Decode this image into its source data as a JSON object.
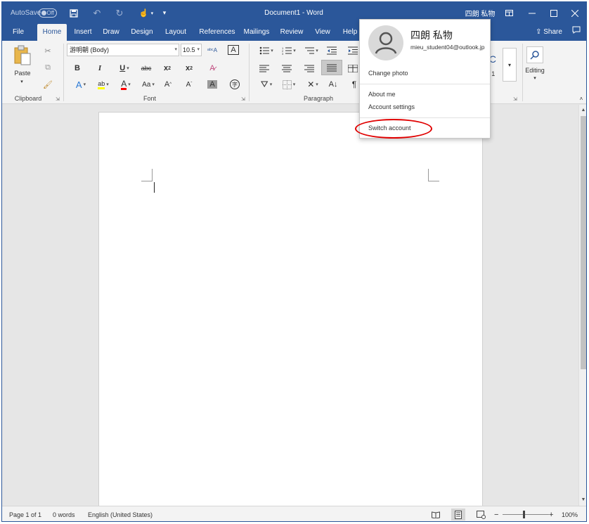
{
  "titlebar": {
    "autosave_label": "AutoSave",
    "autosave_state": "Off",
    "document_title": "Document1  -  Word",
    "user_display": "四朗 私物",
    "window_buttons": [
      "ribbon-display-options",
      "minimize",
      "maximize",
      "close"
    ]
  },
  "tabs": [
    {
      "label": "File"
    },
    {
      "label": "Home"
    },
    {
      "label": "Insert"
    },
    {
      "label": "Draw"
    },
    {
      "label": "Design"
    },
    {
      "label": "Layout"
    },
    {
      "label": "References"
    },
    {
      "label": "Mailings"
    },
    {
      "label": "Review"
    },
    {
      "label": "View"
    },
    {
      "label": "Help"
    }
  ],
  "active_tab": "Home",
  "share_label": "Share",
  "ribbon": {
    "clipboard": {
      "label": "Clipboard",
      "paste_label": "Paste"
    },
    "font": {
      "label": "Font",
      "font_name": "游明朝 (Body)",
      "font_size": "10.5"
    },
    "paragraph": {
      "label": "Paragraph"
    },
    "styles": {
      "partial_label": "g 1",
      "partial_sample": "bC"
    },
    "editing": {
      "label": "Editing"
    }
  },
  "flyout": {
    "name": "四朗 私物",
    "email": "mieu_student04@outlook.jp",
    "change_photo": "Change photo",
    "about_me": "About me",
    "account_settings": "Account settings",
    "switch_account": "Switch account"
  },
  "statusbar": {
    "page": "Page 1 of 1",
    "words": "0 words",
    "language": "English (United States)",
    "zoom_minus": "−",
    "zoom_plus": "+",
    "zoom_level": "100%"
  },
  "colors": {
    "word_blue": "#2b579a",
    "highlight_red": "#e00000",
    "highlighter_yellow": "#ffff00",
    "font_color_red": "#ff0000"
  }
}
